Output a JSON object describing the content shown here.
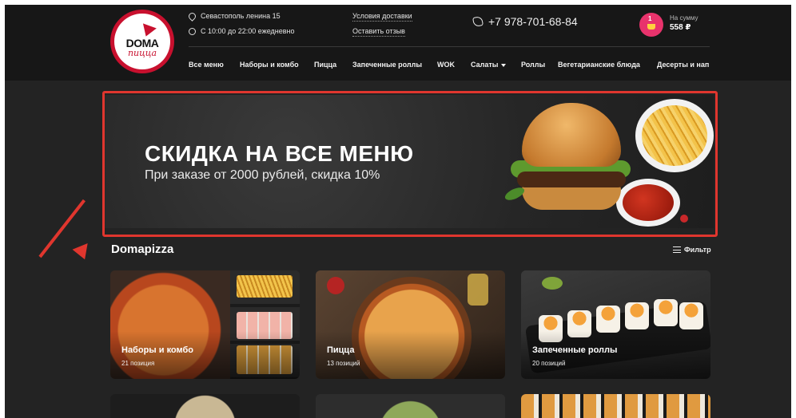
{
  "header": {
    "logo": {
      "line1": "DOMA",
      "line2": "пицца"
    },
    "address": "Севастополь ленина 15",
    "hours": "С 10:00 до 22:00 ежедневно",
    "links": [
      "Условия доставки",
      "Оставить отзыв"
    ],
    "phone": "+7 978-701-68-84",
    "cart": {
      "count": "1",
      "label": "На сумму",
      "sum": "558 ₽"
    },
    "nav": [
      "Все меню",
      "Наборы и комбо",
      "Пицца",
      "Запеченные роллы",
      "WOK",
      "Салаты",
      "Роллы",
      "Вегетарианские блюда",
      "Десерты и нап"
    ]
  },
  "banner": {
    "headline": "СКИДКА НА ВСЕ МЕНЮ",
    "subline": "При заказе от 2000 рублей, скидка 10%"
  },
  "section": {
    "title": "Domapizza",
    "filter_label": "Фильтр"
  },
  "categories": [
    {
      "title": "Наборы и комбо",
      "count": "21 позиция"
    },
    {
      "title": "Пицца",
      "count": "13 позиций"
    },
    {
      "title": "Запеченные роллы",
      "count": "20 позиций"
    }
  ],
  "colors": {
    "accent": "#e0362e",
    "cart": "#e8336c",
    "background": "#232323"
  },
  "icons": [
    "location-icon",
    "clock-icon",
    "phone-icon",
    "cart-icon",
    "filter-icon",
    "chevron-down-icon",
    "arrow-annotation"
  ]
}
